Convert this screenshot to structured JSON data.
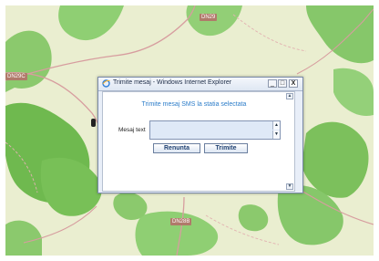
{
  "map": {
    "road_labels": [
      "DN29",
      "DN29C",
      "DN28B"
    ]
  },
  "window": {
    "title": "Trimite mesaj - Windows Internet Explorer",
    "minimize_glyph": "_",
    "maximize_glyph": "□",
    "close_glyph": "X"
  },
  "form": {
    "heading": "Trimite mesaj SMS la statia selectata",
    "message_label": "Mesaj text",
    "message_value": "",
    "cancel_label": "Renunta",
    "send_label": "Trimite"
  },
  "colors": {
    "heading": "#2b7cc9",
    "map_background": "#eaeed0",
    "forest": "#7cc261",
    "road": "#d79d9f"
  }
}
